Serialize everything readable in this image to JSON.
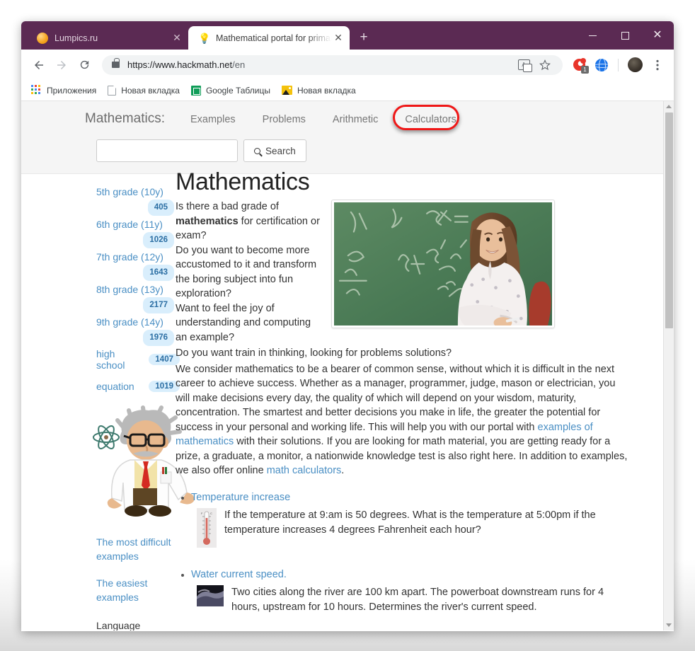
{
  "browser": {
    "tabs": [
      {
        "title": "Lumpics.ru",
        "favicon": "orange-circle-icon",
        "active": false
      },
      {
        "title": "Mathematical portal for primary a",
        "favicon": "lightbulb-icon",
        "active": true
      }
    ],
    "new_tab_label": "+",
    "window_controls": {
      "minimize": "minimize-icon",
      "maximize": "maximize-icon",
      "close": "close-icon"
    },
    "toolbar": {
      "back": "back-arrow-icon",
      "forward": "forward-arrow-icon",
      "reload": "reload-icon",
      "url_host": "https://www.hackmath.net",
      "url_path": "/en",
      "lock": "lock-icon",
      "translate": "translate-icon",
      "bookmark": "star-icon",
      "extension_badge": "1",
      "menu": "three-dot-menu-icon"
    },
    "bookmarks": [
      {
        "label": "Приложения",
        "icon": "apps-grid-icon"
      },
      {
        "label": "Новая вкладка",
        "icon": "page-icon"
      },
      {
        "label": "Google Таблицы",
        "icon": "sheets-icon"
      },
      {
        "label": "Новая вкладка",
        "icon": "image-icon"
      }
    ]
  },
  "site": {
    "brand": "Mathematics:",
    "nav": [
      {
        "label": "Examples",
        "highlighted": false
      },
      {
        "label": "Problems",
        "highlighted": false
      },
      {
        "label": "Arithmetic",
        "highlighted": false
      },
      {
        "label": "Calculators",
        "highlighted": true
      }
    ],
    "search": {
      "value": "",
      "placeholder": "",
      "button": "Search",
      "icon": "search-icon"
    },
    "highlight_color": "#ef1717"
  },
  "sidebar": {
    "grades": [
      {
        "label": "5th grade (10y)",
        "count": "405"
      },
      {
        "label": "6th grade (11y)",
        "count": "1026"
      },
      {
        "label": "7th grade (12y)",
        "count": "1643"
      },
      {
        "label": "8th grade (13y)",
        "count": "2177"
      },
      {
        "label": "9th grade (14y)",
        "count": "1976"
      }
    ],
    "high_school": {
      "label": "high school",
      "count": "1407"
    },
    "equation": {
      "label": "equation",
      "count": "1019"
    },
    "scientist_image": "cartoon-scientist-with-atom",
    "links": [
      "The most difficult examples",
      "The easiest examples"
    ],
    "language_label": "Language"
  },
  "main": {
    "title": "Mathematics",
    "intro_lines": [
      "Is there a bad grade of",
      "mathematics",
      " for certification or exam?",
      "Do you want to become more accustomed to it and transform the boring subject into fun exploration?",
      "Want to feel the joy of understanding and computing an example?",
      "Do you want train in thinking, looking for problems solutions?"
    ],
    "intro_part1": "Is there a bad grade of ",
    "intro_bold": "mathematics",
    "intro_part2": " for certification or exam?",
    "intro_q2": "Do you want to become more accustomed to it and transform the boring subject into fun exploration?",
    "intro_q3": "Want to feel the joy of understanding and computing an example?",
    "intro_q4": "Do you want train in thinking, looking for problems solutions?",
    "photo_alt": "girl-at-chalkboard-photo",
    "paragraph_1": "We consider mathematics to be a bearer of common sense, without which it is difficult in the next career to achieve success. Whether as a manager, programmer, judge, mason or electrician, you will make decisions every day, the quality of which will depend on your wisdom, maturity, concentration. The smartest and better decisions you make in life, the greater the potential for success in your personal and working life. This will help you with our portal with ",
    "link_examples": "examples of mathematics",
    "paragraph_2": " with their solutions. If you are looking for math material, you are getting ready for a prize, a graduate, a monitor, a nationwide knowledge test is also right here. In addition to examples, we also offer online ",
    "link_calculators": "math calculators",
    "paragraph_3": ".",
    "problems": [
      {
        "title": "Temperature increase",
        "text": "If the temperature at 9:am is 50 degrees. What is the temperature at 5:00pm if the temperature increases 4 degrees Fahrenheit each hour?",
        "thumb": "thermometer-icon"
      },
      {
        "title": "Water current speed.",
        "text": "Two cities along the river are 100 km apart. The powerboat downstream runs for 4 hours, upstream for 10 hours. Determines the river's current speed.",
        "thumb": "river-photo-icon"
      }
    ]
  }
}
